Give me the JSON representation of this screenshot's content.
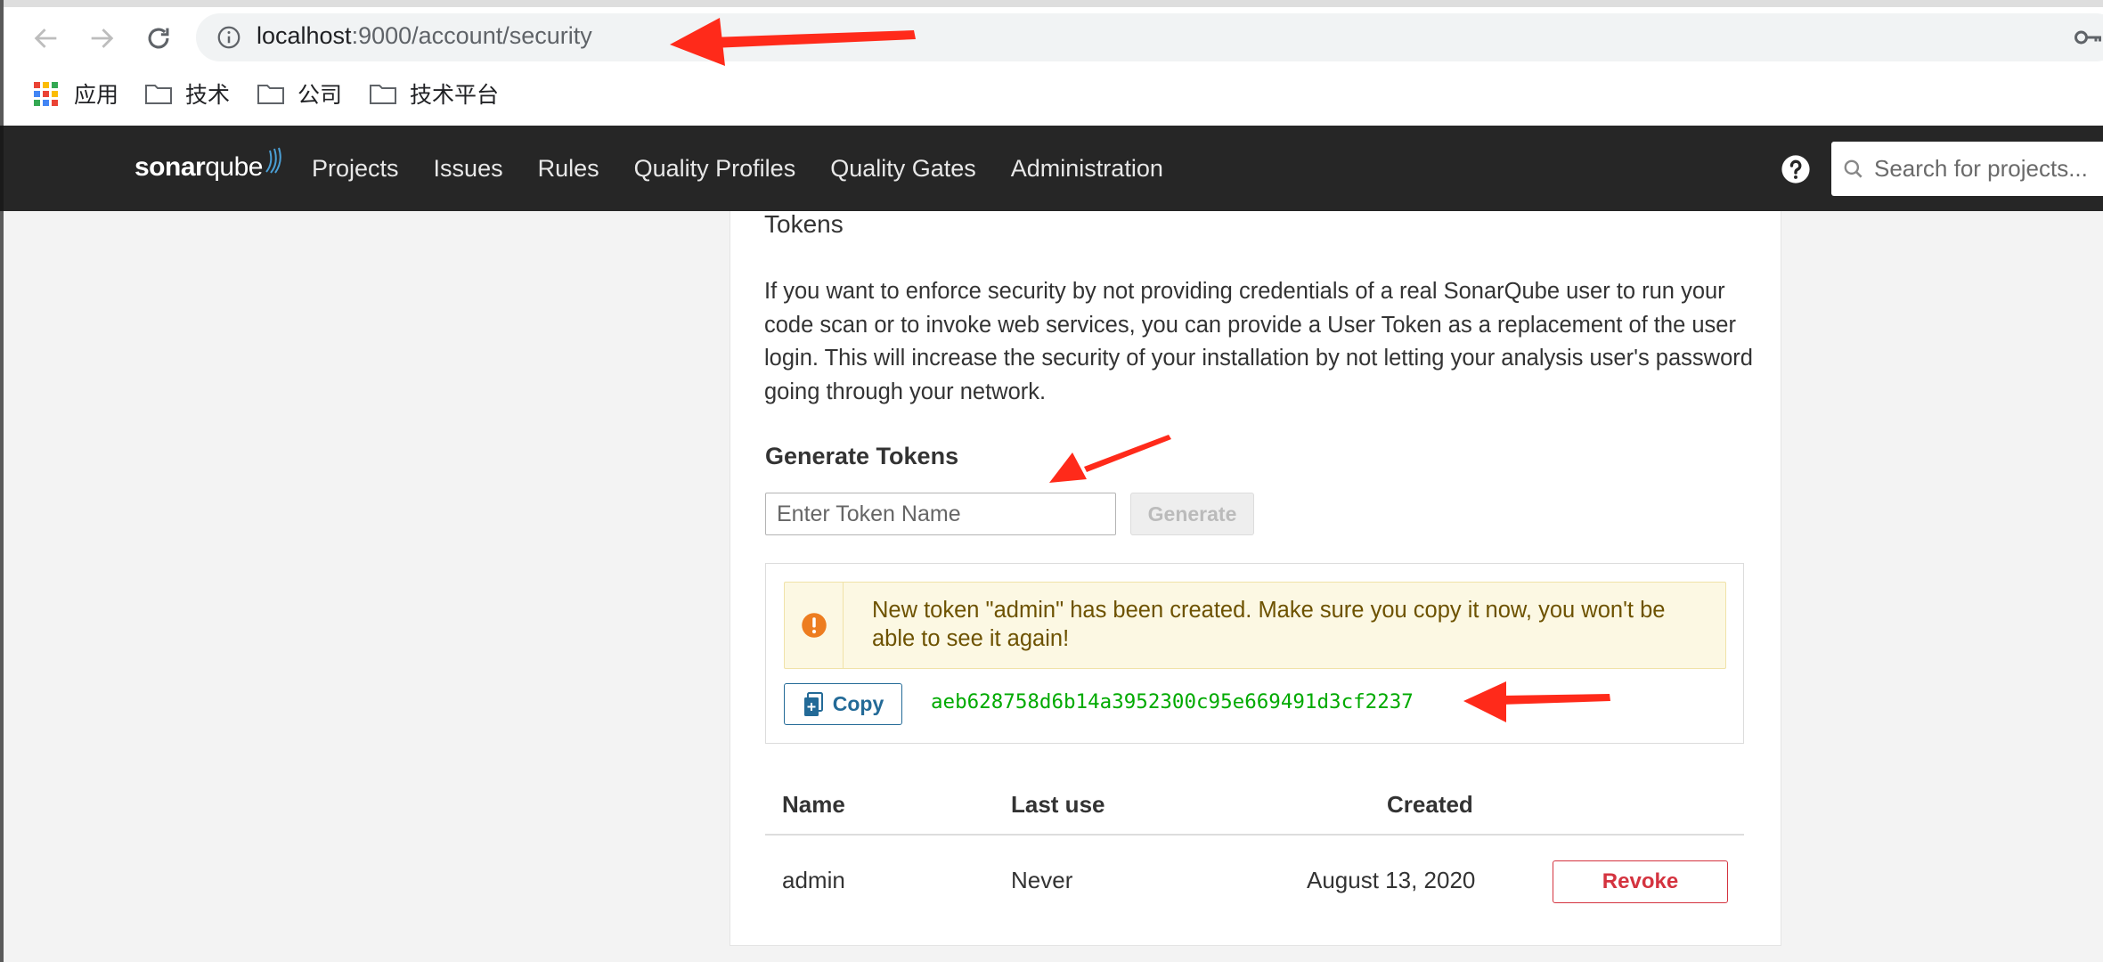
{
  "browser": {
    "url_host": "localhost",
    "url_path": ":9000/account/security",
    "bookmarks": [
      {
        "label": "应用",
        "icon": "apps-grid-icon"
      },
      {
        "label": "技术",
        "icon": "folder-icon"
      },
      {
        "label": "公司",
        "icon": "folder-icon"
      },
      {
        "label": "技术平台",
        "icon": "folder-icon"
      }
    ]
  },
  "nav": {
    "logo_sonar": "sonar",
    "logo_qube": "qube",
    "menu": [
      "Projects",
      "Issues",
      "Rules",
      "Quality Profiles",
      "Quality Gates",
      "Administration"
    ],
    "search_placeholder": "Search for projects..."
  },
  "tokens": {
    "title": "Tokens",
    "description": "If you want to enforce security by not providing credentials of a real SonarQube user to run your code scan or to invoke web services, you can provide a User Token as a replacement of the user login. This will increase the security of your installation by not letting your analysis user's password going through your network.",
    "generate_title": "Generate Tokens",
    "input_placeholder": "Enter Token Name",
    "generate_label": "Generate",
    "warning_message": "New token \"admin\" has been created. Make sure you copy it now, you won't be able to see it again!",
    "copy_label": "Copy",
    "token_value": "aeb628758d6b14a3952300c95e669491d3cf2237"
  },
  "table": {
    "headers": {
      "name": "Name",
      "last_use": "Last use",
      "created": "Created"
    },
    "rows": [
      {
        "name": "admin",
        "last_use": "Never",
        "created": "August 13, 2020",
        "action": "Revoke"
      }
    ]
  },
  "colors": {
    "nav_bg": "#262626",
    "token_green": "#00aa00",
    "warning_bg": "#fcf8e3",
    "warning_icon": "#ed7d20",
    "copy_blue": "#236a97",
    "revoke_red": "#d4333f",
    "annotation_red": "#ff2a1a"
  }
}
